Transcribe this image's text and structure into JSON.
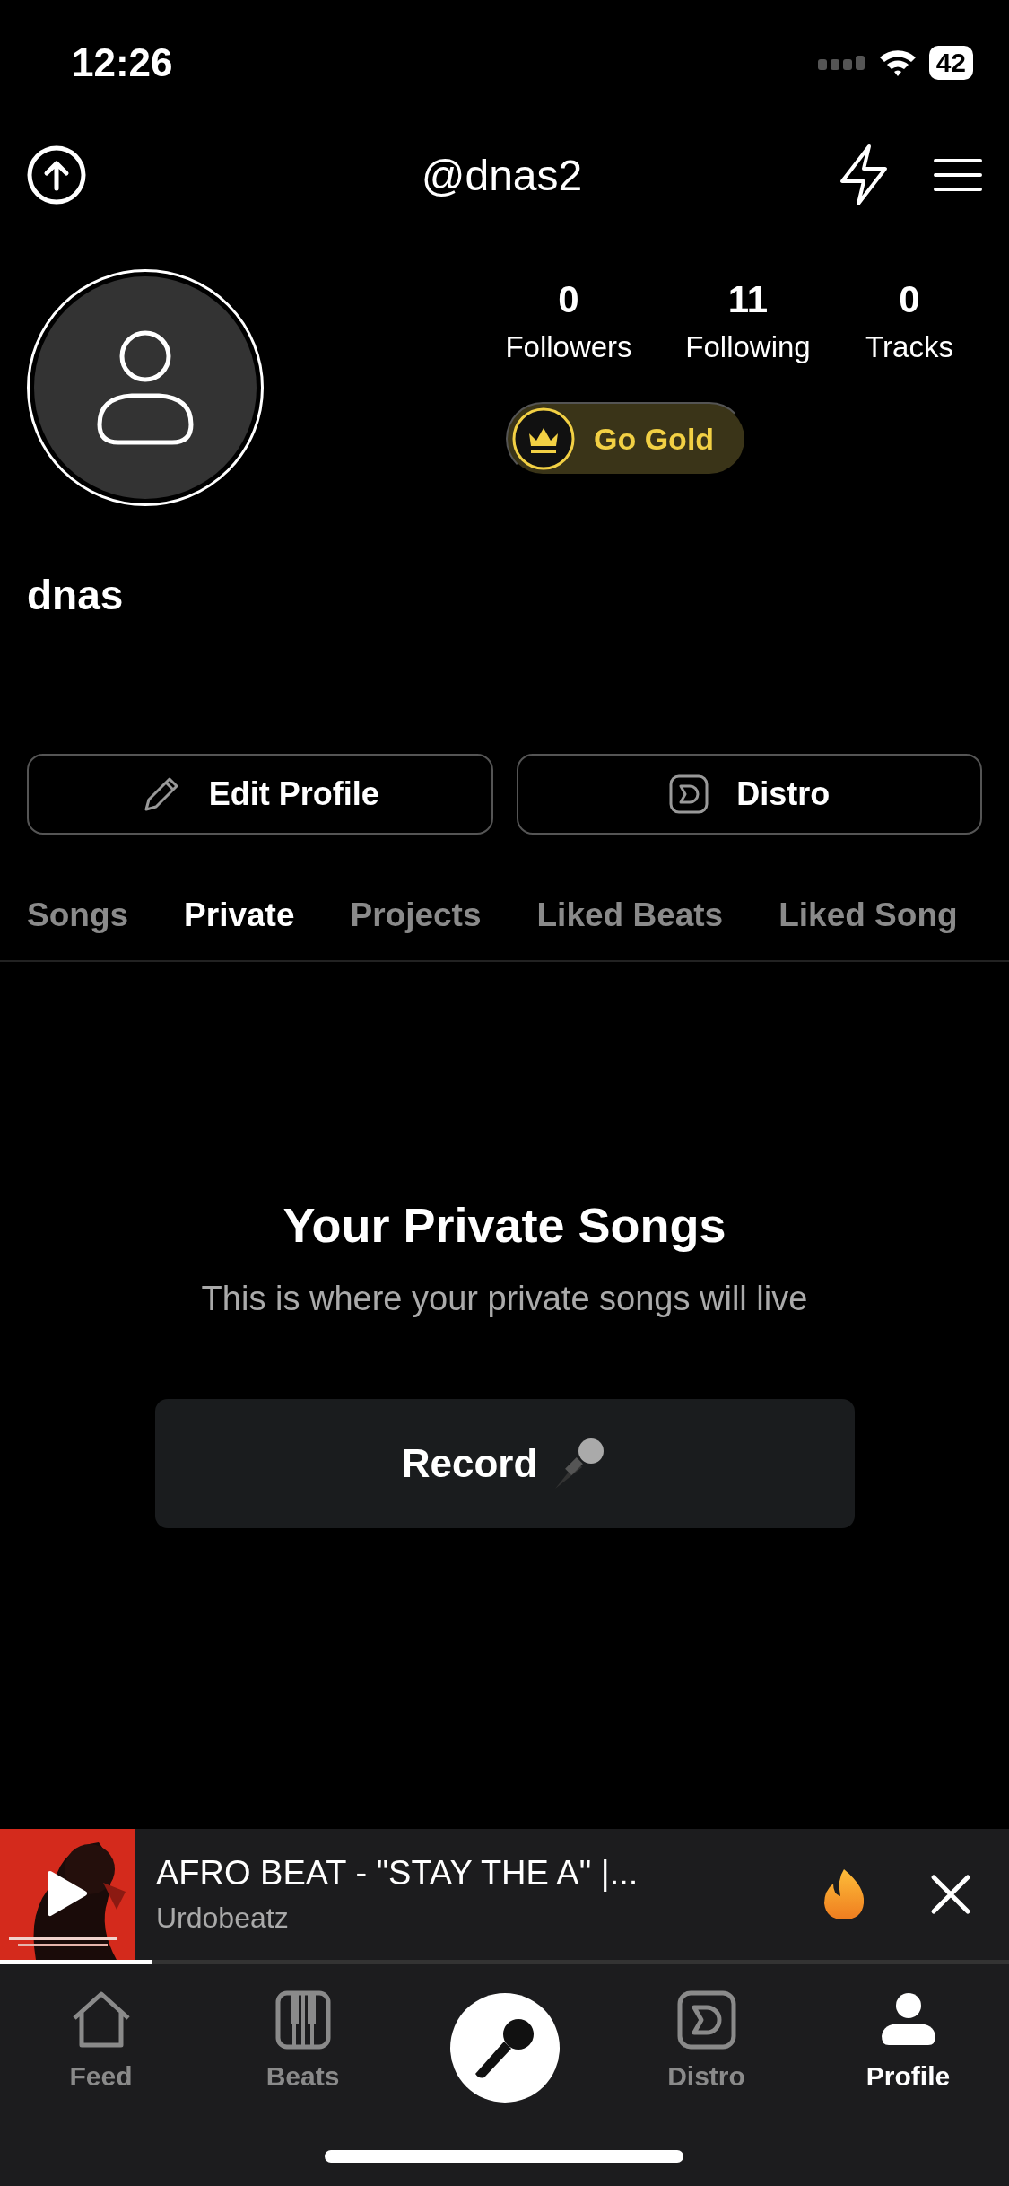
{
  "status_bar": {
    "time": "12:26",
    "battery": "42"
  },
  "header": {
    "handle": "@dnas2"
  },
  "profile": {
    "name": "dnas",
    "stats": [
      {
        "value": "0",
        "label": "Followers"
      },
      {
        "value": "11",
        "label": "Following"
      },
      {
        "value": "0",
        "label": "Tracks"
      }
    ],
    "gold_button": "Go Gold"
  },
  "actions": [
    {
      "kind": "edit",
      "label": "Edit Profile"
    },
    {
      "kind": "distro",
      "label": "Distro"
    }
  ],
  "tabs": [
    {
      "label": "Songs",
      "selected": false
    },
    {
      "label": "Private",
      "selected": true
    },
    {
      "label": "Projects",
      "selected": false
    },
    {
      "label": "Liked Beats",
      "selected": false
    },
    {
      "label": "Liked Song",
      "selected": false
    }
  ],
  "empty_state": {
    "title": "Your Private Songs",
    "message": "This is where your private songs will live",
    "button": "Record"
  },
  "player": {
    "title": "AFRO BEAT - \"STAY THE A\" |...",
    "artist": "Urdobeatz",
    "level": 0.15
  },
  "nav": [
    {
      "kind": "home",
      "label": "Feed",
      "selected": false
    },
    {
      "kind": "piano",
      "label": "Beats",
      "selected": false
    },
    {
      "kind": "mic",
      "selected": false
    },
    {
      "kind": "distro",
      "label": "Distro",
      "selected": false
    },
    {
      "kind": "person",
      "label": "Profile",
      "selected": true
    }
  ]
}
